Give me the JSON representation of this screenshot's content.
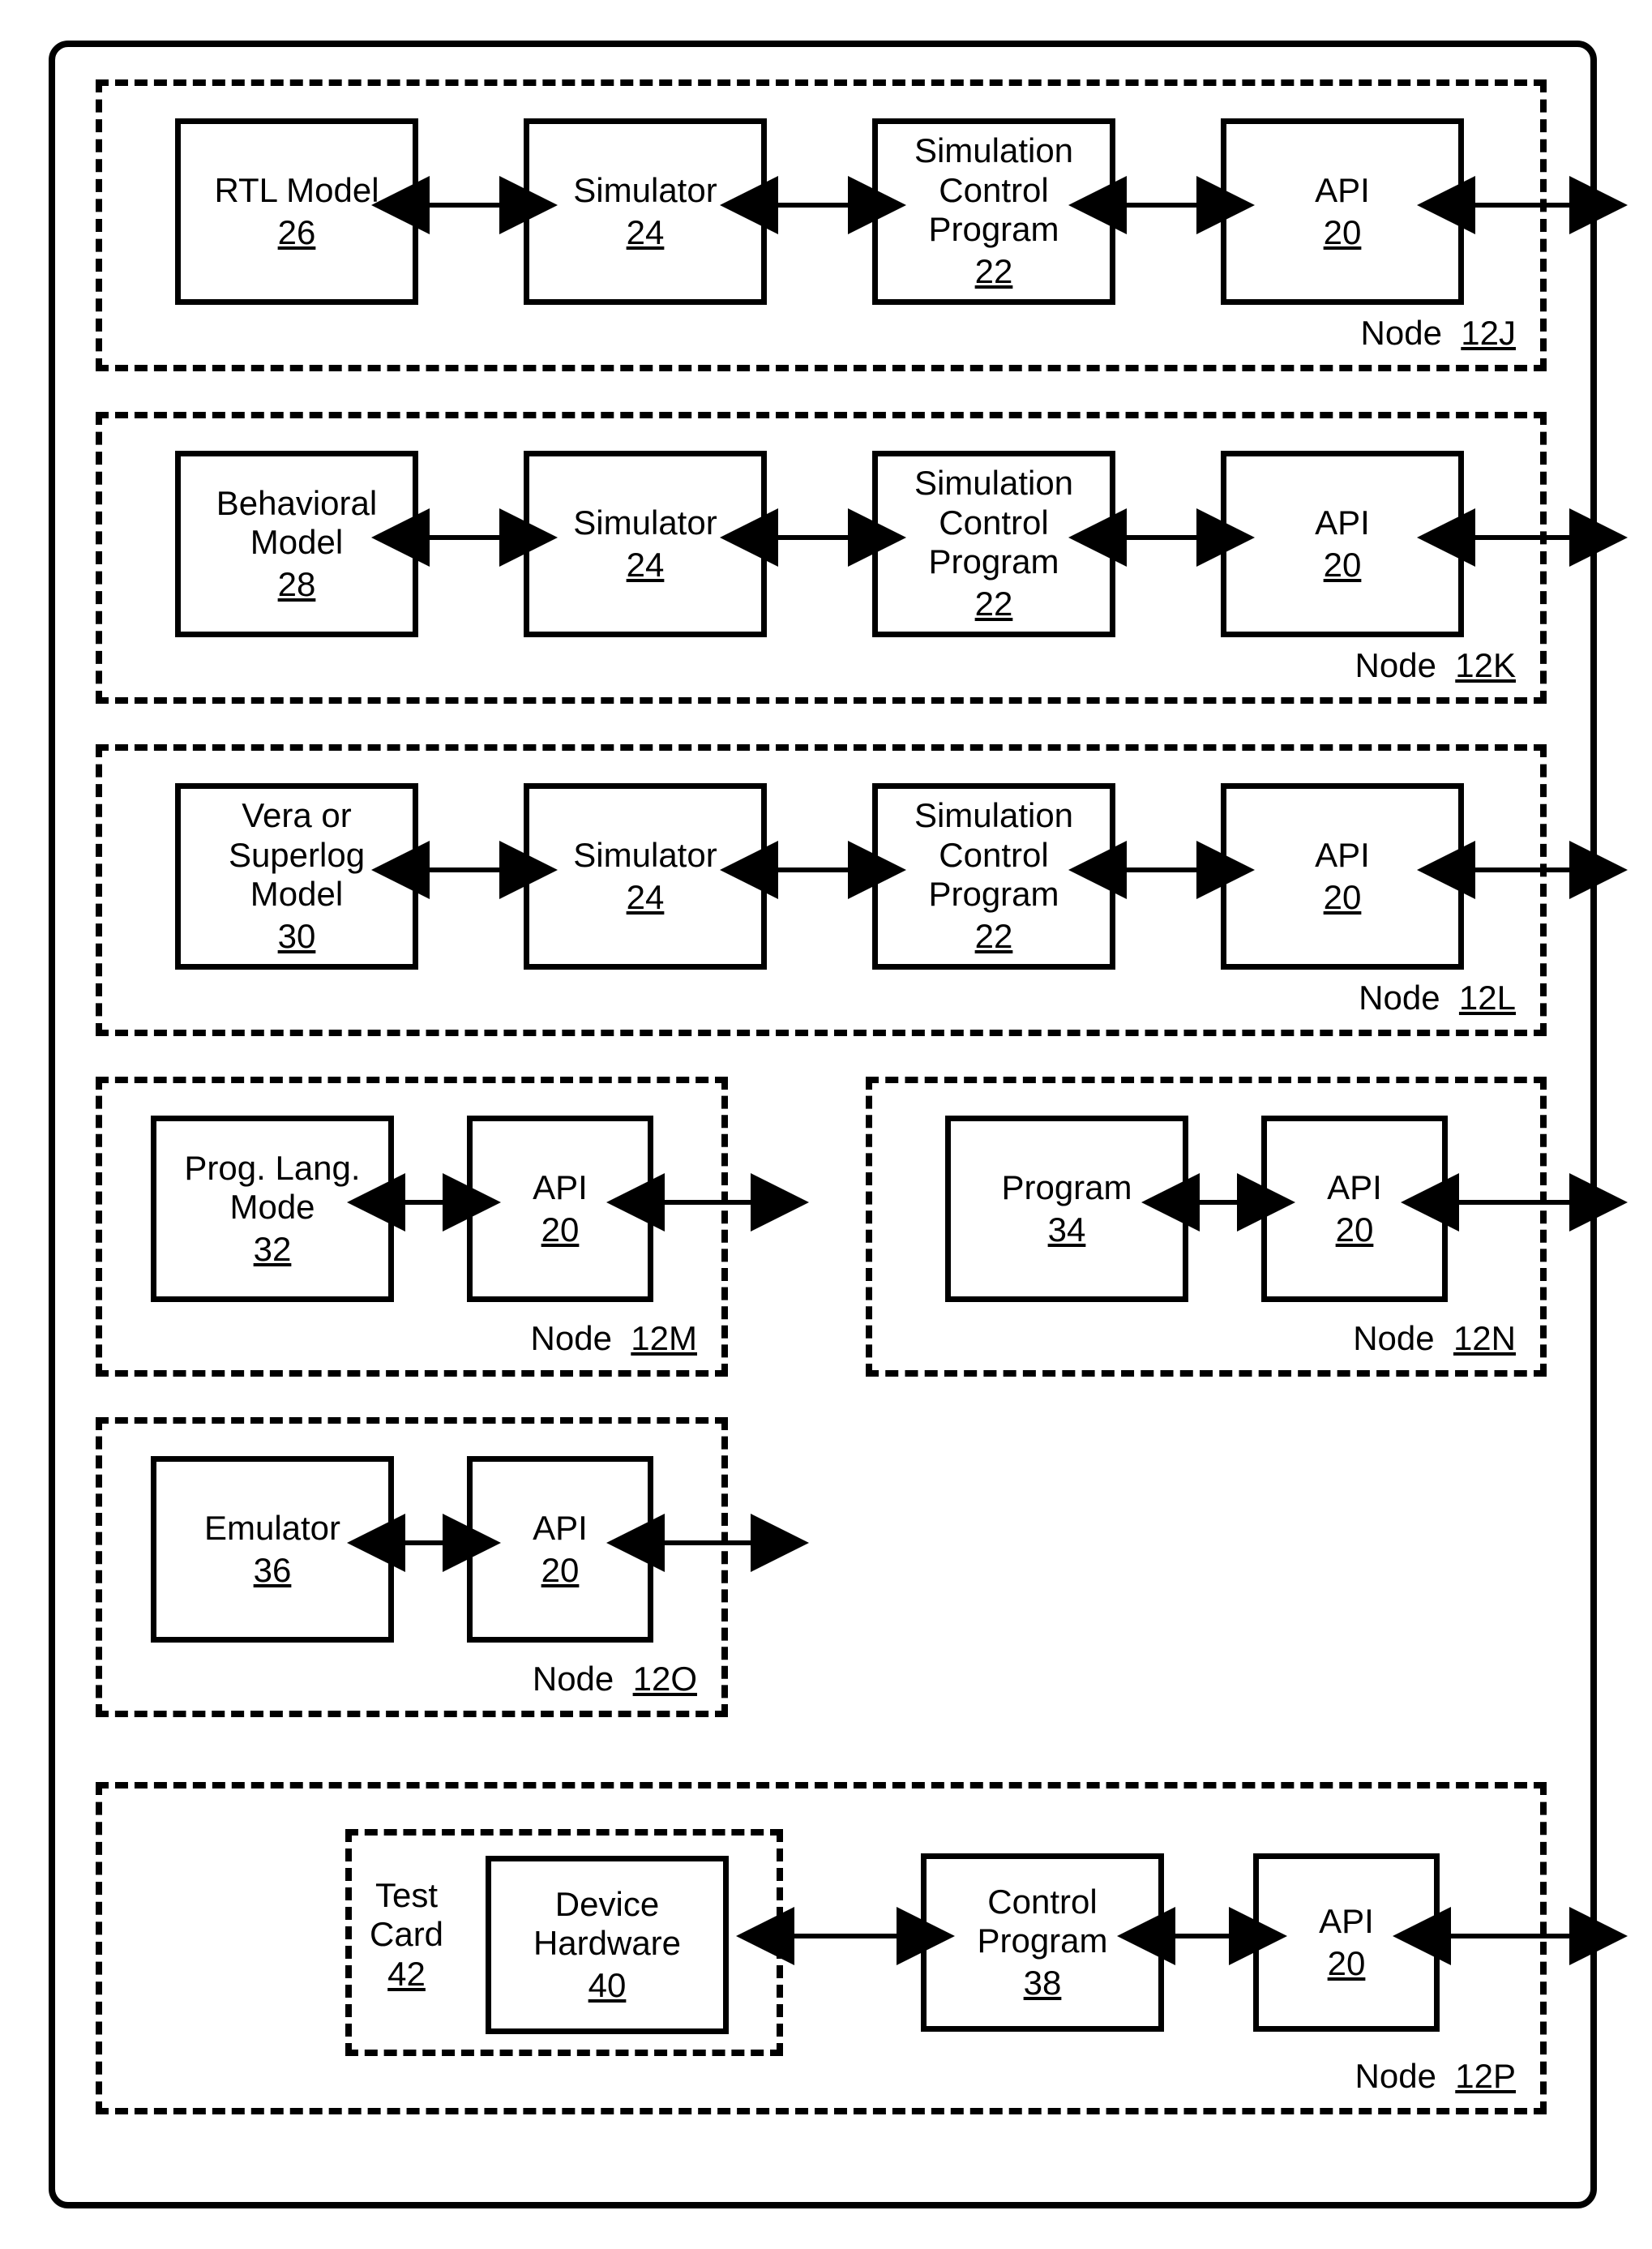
{
  "nodes": {
    "j": {
      "label_prefix": "Node",
      "id": "12J",
      "boxes": {
        "rtl": {
          "line1": "RTL Model",
          "ref": "26"
        },
        "sim": {
          "line1": "Simulator",
          "ref": "24"
        },
        "scp": {
          "line1": "Simulation",
          "line2": "Control",
          "line3": "Program",
          "ref": "22"
        },
        "api": {
          "line1": "API",
          "ref": "20"
        }
      }
    },
    "k": {
      "label_prefix": "Node",
      "id": "12K",
      "boxes": {
        "beh": {
          "line1": "Behavioral",
          "line2": "Model",
          "ref": "28"
        },
        "sim": {
          "line1": "Simulator",
          "ref": "24"
        },
        "scp": {
          "line1": "Simulation",
          "line2": "Control",
          "line3": "Program",
          "ref": "22"
        },
        "api": {
          "line1": "API",
          "ref": "20"
        }
      }
    },
    "l": {
      "label_prefix": "Node",
      "id": "12L",
      "boxes": {
        "vera": {
          "line1": "Vera or",
          "line2": "Superlog",
          "line3": "Model",
          "ref": "30"
        },
        "sim": {
          "line1": "Simulator",
          "ref": "24"
        },
        "scp": {
          "line1": "Simulation",
          "line2": "Control",
          "line3": "Program",
          "ref": "22"
        },
        "api": {
          "line1": "API",
          "ref": "20"
        }
      }
    },
    "m": {
      "label_prefix": "Node",
      "id": "12M",
      "boxes": {
        "plm": {
          "line1": "Prog. Lang.",
          "line2": "Mode",
          "ref": "32"
        },
        "api": {
          "line1": "API",
          "ref": "20"
        }
      }
    },
    "n": {
      "label_prefix": "Node",
      "id": "12N",
      "boxes": {
        "prog": {
          "line1": "Program",
          "ref": "34"
        },
        "api": {
          "line1": "API",
          "ref": "20"
        }
      }
    },
    "o": {
      "label_prefix": "Node",
      "id": "12O",
      "boxes": {
        "emu": {
          "line1": "Emulator",
          "ref": "36"
        },
        "api": {
          "line1": "API",
          "ref": "20"
        }
      }
    },
    "p": {
      "label_prefix": "Node",
      "id": "12P",
      "testcard": {
        "line1": "Test",
        "line2": "Card",
        "ref": "42"
      },
      "boxes": {
        "dev": {
          "line1": "Device",
          "line2": "Hardware",
          "ref": "40"
        },
        "cp": {
          "line1": "Control",
          "line2": "Program",
          "ref": "38"
        },
        "api": {
          "line1": "API",
          "ref": "20"
        }
      }
    }
  }
}
